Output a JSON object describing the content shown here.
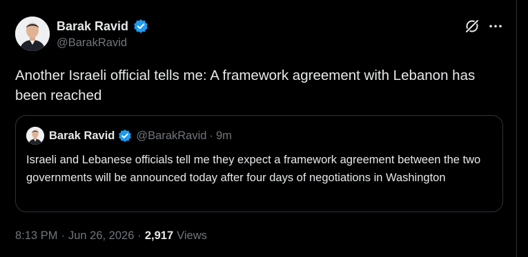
{
  "tweet": {
    "author": {
      "name": "Barak Ravid",
      "handle": "@BarakRavid",
      "verified": true
    },
    "text": "Another Israeli official tells me: A framework agreement with Lebanon has been reached",
    "time": "8:13 PM",
    "date": "Jun 26, 2026",
    "separator": "·",
    "views_count": "2,917",
    "views_label": "Views"
  },
  "quote": {
    "author": {
      "name": "Barak Ravid",
      "handle": "@BarakRavid",
      "verified": true
    },
    "separator": "·",
    "time_ago": "9m",
    "text": "Israeli and Lebanese officials tell me they expect a framework agreement between the two governments will be announced today after four days of negotiations in Washington"
  },
  "icons": {
    "verified": "verified-badge-icon",
    "grok": "grok-icon",
    "more": "more-horizontal-icon"
  },
  "colors": {
    "background": "#000000",
    "text": "#e7e9ea",
    "secondary_text": "#71767b",
    "verified_blue": "#1d9bf0",
    "border": "#2f3336"
  }
}
